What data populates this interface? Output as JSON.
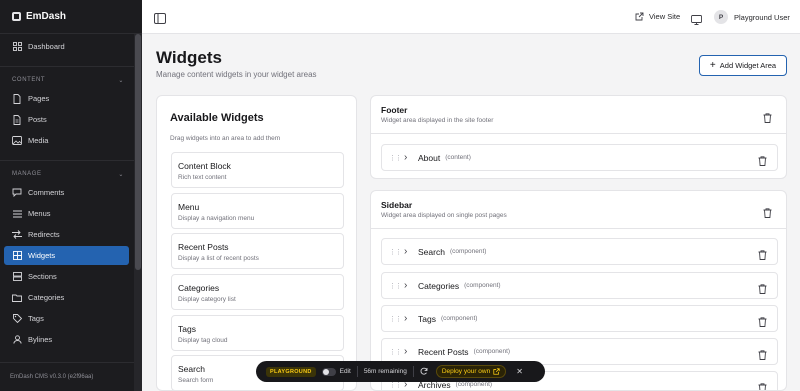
{
  "sidebar": {
    "brand": "EmDash",
    "dashboard": "Dashboard",
    "content_label": "CONTENT",
    "content_items": [
      "Pages",
      "Posts",
      "Media"
    ],
    "manage_label": "MANAGE",
    "manage_items": [
      "Comments",
      "Menus",
      "Redirects",
      "Widgets",
      "Sections",
      "Categories",
      "Tags",
      "Bylines"
    ],
    "active_item": "Widgets",
    "version": "EmDash CMS v0.3.0 (e2f96aa)"
  },
  "topbar": {
    "view_site": "View Site",
    "user_initial": "P",
    "user_name": "Playground User"
  },
  "page": {
    "title": "Widgets",
    "subtitle": "Manage content widgets in your widget areas",
    "add_button": "Add Widget Area"
  },
  "available": {
    "title": "Available Widgets",
    "subtitle": "Drag widgets into an area to add them",
    "widgets": [
      {
        "name": "Content Block",
        "desc": "Rich text content"
      },
      {
        "name": "Menu",
        "desc": "Display a navigation menu"
      },
      {
        "name": "Recent Posts",
        "desc": "Display a list of recent posts"
      },
      {
        "name": "Categories",
        "desc": "Display category list"
      },
      {
        "name": "Tags",
        "desc": "Display tag cloud"
      },
      {
        "name": "Search",
        "desc": "Search form"
      }
    ]
  },
  "areas": [
    {
      "title": "Footer",
      "desc": "Widget area displayed in the site footer",
      "rows": [
        {
          "name": "About",
          "type": "(content)"
        }
      ]
    },
    {
      "title": "Sidebar",
      "desc": "Widget area displayed on single post pages",
      "rows": [
        {
          "name": "Search",
          "type": "(component)"
        },
        {
          "name": "Categories",
          "type": "(component)"
        },
        {
          "name": "Tags",
          "type": "(component)"
        },
        {
          "name": "Recent Posts",
          "type": "(component)"
        },
        {
          "name": "Archives",
          "type": "(component)"
        }
      ]
    }
  ],
  "playground": {
    "badge": "PLAYGROUND",
    "edit": "Edit",
    "remaining": "56m remaining",
    "deploy": "Deploy your own"
  },
  "colors": {
    "accent": "#2463b0",
    "sidebar_bg": "#1c1c1f",
    "badge_text": "#facc15"
  }
}
